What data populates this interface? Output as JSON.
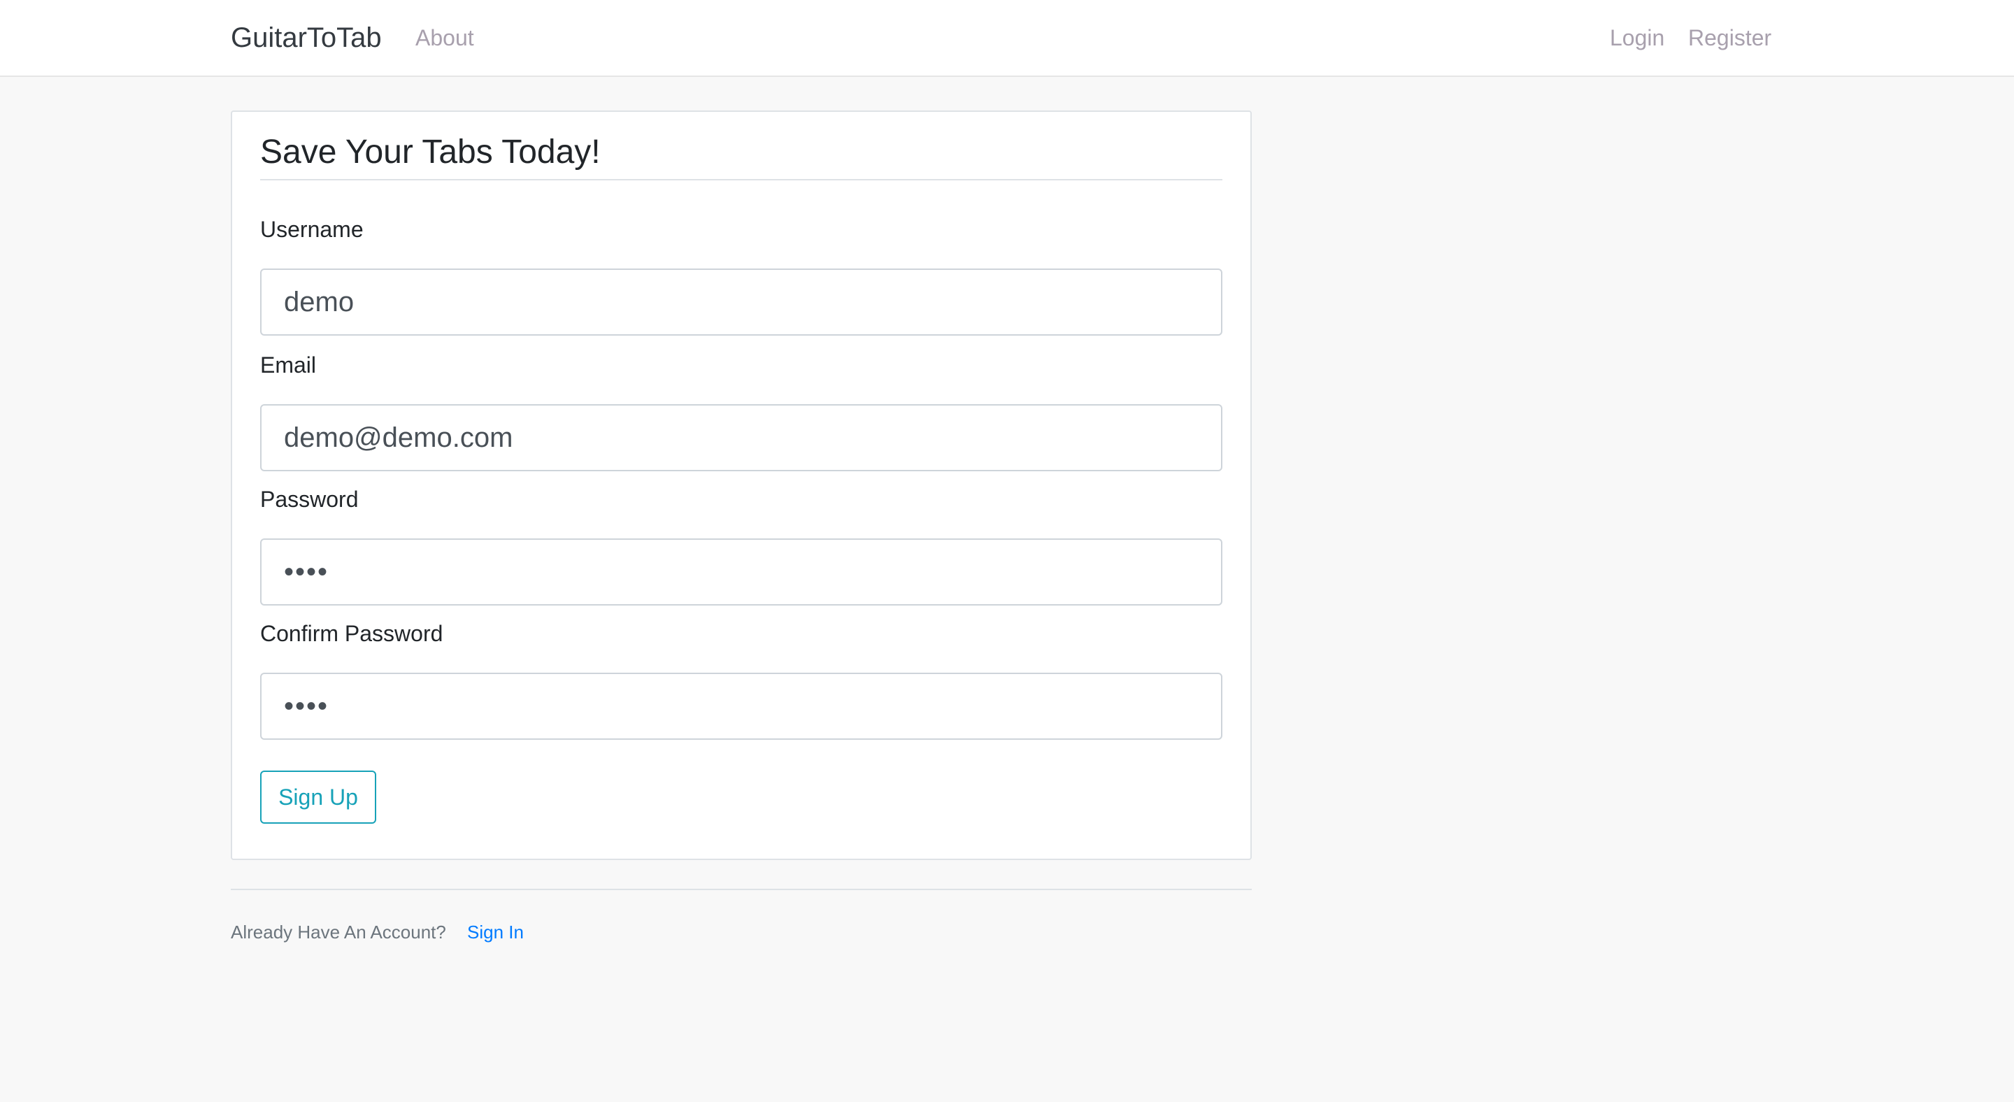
{
  "navbar": {
    "brand": "GuitarToTab",
    "links": {
      "about": "About",
      "login": "Login",
      "register": "Register"
    }
  },
  "form": {
    "legend": "Save Your Tabs Today!",
    "username": {
      "label": "Username",
      "value": "demo"
    },
    "email": {
      "label": "Email",
      "value": "demo@demo.com"
    },
    "password": {
      "label": "Password",
      "value": "••••"
    },
    "confirm_password": {
      "label": "Confirm Password",
      "value": "••••"
    },
    "submit_label": "Sign Up"
  },
  "footer": {
    "prompt": "Already Have An Account?",
    "link_label": "Sign In"
  },
  "colors": {
    "accent_info": "#17a2b8",
    "link_primary": "#007bff",
    "nav_muted": "#a8a0ad",
    "background": "#f8f8f8"
  }
}
